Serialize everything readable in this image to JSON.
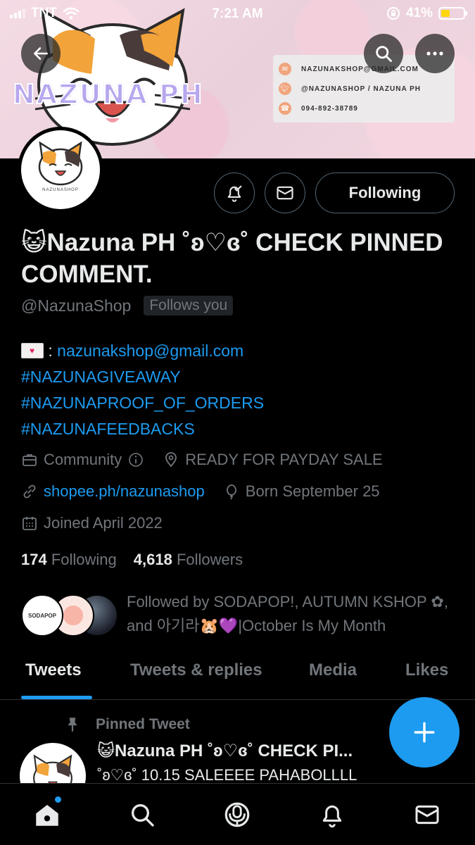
{
  "status_bar": {
    "carrier": "TNT",
    "time": "7:21 AM",
    "battery_percent": "41%",
    "battery_level": 0.41,
    "battery_color": "#ffd60a"
  },
  "banner": {
    "brand": "NAZUNA PH",
    "email": "NAZUNAKSHOP@GMAIL.COM",
    "twitter": "@NAZUNASHOP / NAZUNA PH",
    "phone": "094-892-38789"
  },
  "avatar": {
    "caption": "NAZUNASHOP"
  },
  "actions": {
    "following_label": "Following"
  },
  "profile": {
    "emoji": "😺",
    "name": "Nazuna PH ˚ʚ♡ɞ˚ CHECK PINNED COMMENT.",
    "handle": "@NazunaShop",
    "follows_you": "Follows you",
    "bio": {
      "email_prefix": " : ",
      "email": "nazunakshop@gmail.com",
      "tags": [
        "#NAZUNAGIVEAWAY",
        "#NAZUNAPROOF_OF_ORDERS",
        "#NAZUNAFEEDBACKS"
      ]
    },
    "category": "Community",
    "location": "READY FOR PAYDAY SALE",
    "website": "shopee.ph/nazunashop",
    "birthday": "Born September 25",
    "joined": "Joined April 2022",
    "following_count": "174",
    "following_label": "Following",
    "followers_count": "4,618",
    "followers_label": "Followers",
    "followed_by": "Followed by SODAPOP!, AUTUMN KSHOP ✿, and 아기라🐹💜|October Is My Month",
    "followed_avatar_label": "SODAPOP"
  },
  "tabs": [
    "Tweets",
    "Tweets & replies",
    "Media",
    "Likes"
  ],
  "pinned": {
    "label": "Pinned Tweet",
    "title": "😺Nazuna PH ˚ʚ♡ɞ˚ CHECK PI...",
    "body": "˚ʚ♡ɞ˚ 10.15 SALEEEE PAHABOLLLL"
  },
  "colors": {
    "accent": "#1d9bf0",
    "muted": "#71767b",
    "text": "#e7e9ea",
    "background": "#000000"
  },
  "icons": {
    "back": "arrow-left-icon",
    "search": "search-icon",
    "more": "more-icon",
    "notify": "bell-check-icon",
    "message": "envelope-icon",
    "category": "briefcase-icon",
    "info": "info-icon",
    "location": "location-pin-icon",
    "link": "link-icon",
    "birthday": "balloon-icon",
    "calendar": "calendar-icon",
    "pin": "pin-icon",
    "compose": "plus-icon",
    "nav": [
      "home-icon",
      "search-icon",
      "spaces-icon",
      "bell-icon",
      "envelope-icon"
    ]
  }
}
